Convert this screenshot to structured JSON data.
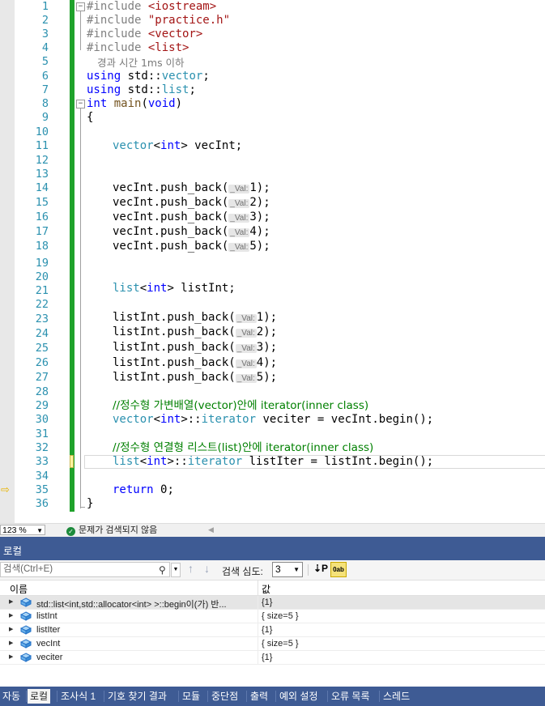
{
  "editor": {
    "line_numbers": [
      "1",
      "2",
      "3",
      "4",
      "5",
      "6",
      "7",
      "8",
      "9",
      "10",
      "11",
      "12",
      "13",
      "14",
      "15",
      "16",
      "17",
      "18",
      "19",
      "20",
      "21",
      "22",
      "23",
      "24",
      "25",
      "26",
      "27",
      "28",
      "29",
      "30",
      "31",
      "32",
      "33",
      "34",
      "35",
      "36"
    ],
    "perf_tip": "경과 시간 1ms 이하",
    "param_hint": "_Val:",
    "code": {
      "inc1_kw": "#include ",
      "inc1_file": "<iostream>",
      "inc2_kw": "#include ",
      "inc2_file": "\"practice.h\"",
      "inc3_kw": "#include ",
      "inc3_file": "<vector>",
      "inc4_kw": "#include ",
      "inc4_file": "<list>",
      "using1_kw": "using ",
      "using1_ns": "std",
      "using1_sep": "::",
      "using1_ty": "vector",
      "using1_end": ";",
      "using2_kw": "using ",
      "using2_ns": "std",
      "using2_sep": "::",
      "using2_ty": "list",
      "using2_end": ";",
      "main_kw": "int ",
      "main_fn": "main",
      "main_open": "(",
      "main_void": "void",
      "main_close": ")",
      "brace_open": "{",
      "vec_decl_ty": "vector",
      "vec_decl_lt": "<",
      "vec_decl_int": "int",
      "vec_decl_rest": "> vecInt;",
      "vec_push": [
        "vecInt.push_back(",
        "vecInt.push_back(",
        "vecInt.push_back(",
        "vecInt.push_back(",
        "vecInt.push_back("
      ],
      "vec_args": [
        "1);",
        "2);",
        "3);",
        "4);",
        "5);"
      ],
      "list_decl_ty": "list",
      "list_decl_lt": "<",
      "list_decl_int": "int",
      "list_decl_rest": "> listInt;",
      "list_push": [
        "listInt.push_back(",
        "listInt.push_back(",
        "listInt.push_back(",
        "listInt.push_back(",
        "listInt.push_back("
      ],
      "list_args": [
        "1);",
        "2);",
        "3);",
        "4);",
        "5);"
      ],
      "comment1": "//정수형 가변배열(vector)안에 iterator(inner class)",
      "vit_ty": "vector",
      "vit_lt": "<",
      "vit_int": "int",
      "vit_gt": ">",
      "vit_sep": "::",
      "vit_it": "iterator",
      "vit_rest": " veciter = vecInt.begin();",
      "comment2": "//정수형 연결형 리스트(list)안에 iterator(inner class)",
      "lit_ty": "list",
      "lit_lt": "<",
      "lit_int": "int",
      "lit_gt": ">",
      "lit_sep": "::",
      "lit_it": "iterator",
      "lit_rest": " listIter = listInt.begin();",
      "ret_kw": "return ",
      "ret_val": "0;",
      "brace_close": "}"
    }
  },
  "status": {
    "zoom": "123 %",
    "issues": "문제가 검색되지 않음"
  },
  "locals": {
    "title": "로컬",
    "search_placeholder": "검색(Ctrl+E)",
    "search_depth_label": "검색 심도:",
    "search_depth_value": "3",
    "col_name": "이름",
    "col_value": "값",
    "rows": [
      {
        "name": "std::list<int,std::allocator<int> >::begin이(가) 반...",
        "value": "{1}"
      },
      {
        "name": "listInt",
        "value": "{ size=5 }"
      },
      {
        "name": "listIter",
        "value": "{1}"
      },
      {
        "name": "vecInt",
        "value": "{ size=5 }"
      },
      {
        "name": "veciter",
        "value": "{1}"
      }
    ]
  },
  "tabs": [
    "자동",
    "로컬",
    "조사식 1",
    "기호 찾기 결과",
    "모듈",
    "중단점",
    "출력",
    "예외 설정",
    "오류 목록",
    "스레드"
  ],
  "active_tab": "로컬",
  "colors": {
    "keyword": "#0000ff",
    "string": "#a31515",
    "type": "#2b91af",
    "comment": "#008000",
    "change_bar": "#1fa22b",
    "panel_header": "#3e5b94"
  }
}
